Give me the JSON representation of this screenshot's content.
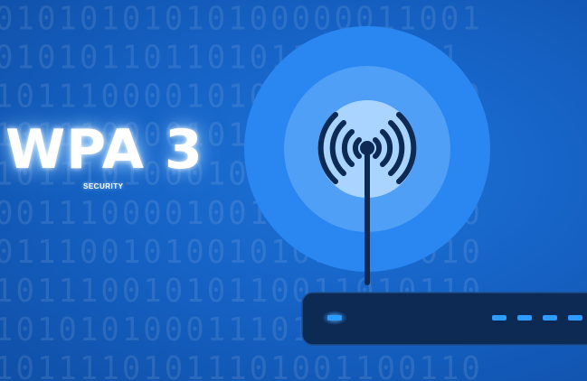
{
  "title": "WPA 3",
  "subtitle": "SECURITY",
  "binary_rows": [
    "01010101010100000011001",
    "0101011011010110001011",
    "10111000010100101011000",
    "10111000010100101010110",
    "10111010001010100101011",
    "00111000010011101010110",
    "01110010100101011001010",
    "10111001010110011010110",
    "10101010001110101011010",
    "10111101011101001100110"
  ],
  "icons": {
    "wifi": "wifi-signal-icon",
    "router": "router-icon"
  },
  "colors": {
    "background": "#1663c6",
    "outer_ring": "#2a86f0",
    "mid_ring": "#4ea0f6",
    "inner_circle": "#a9d4ff",
    "device": "#0d2a55",
    "led": "#2d9bff"
  }
}
